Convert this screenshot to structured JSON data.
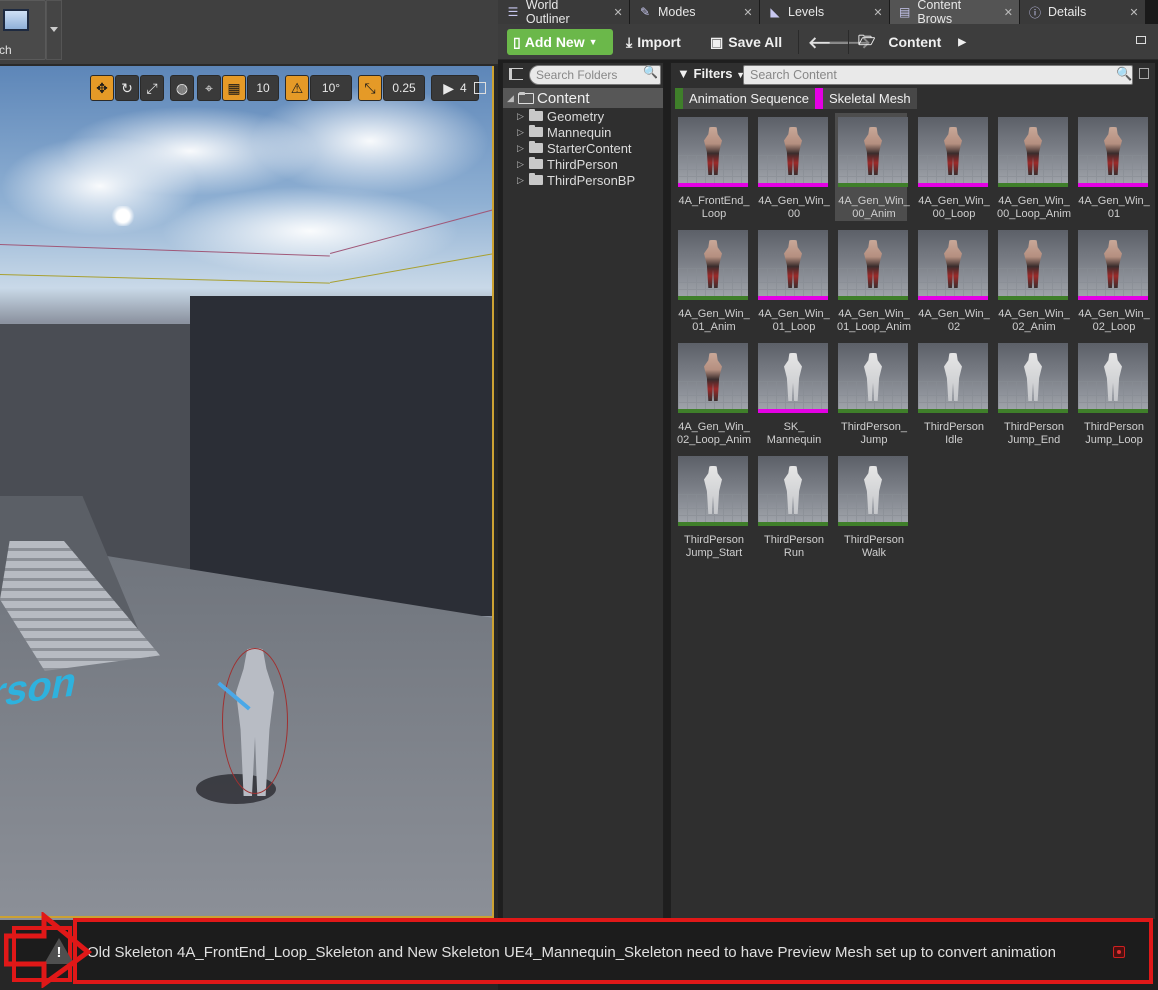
{
  "main_toolbar": {
    "launch_label": "ch"
  },
  "viewport": {
    "grid_snap": "10",
    "rot_snap": "10°",
    "scale_snap": "0.25",
    "camera_speed": "4",
    "floor_text": "rson"
  },
  "tabs": [
    {
      "label": "World Outliner",
      "icon": "list-icon",
      "active": false
    },
    {
      "label": "Modes",
      "icon": "modes-icon",
      "active": false
    },
    {
      "label": "Levels",
      "icon": "levels-icon",
      "active": false
    },
    {
      "label": "Content Brows",
      "icon": "content-browser-icon",
      "active": true
    },
    {
      "label": "Details",
      "icon": "details-icon",
      "active": false
    }
  ],
  "cb_toolbar": {
    "add_new": "Add New",
    "import": "Import",
    "save_all": "Save All",
    "path_root": "Content"
  },
  "folders": {
    "search_placeholder": "Search Folders",
    "root": "Content",
    "children": [
      "Geometry",
      "Mannequin",
      "StarterContent",
      "ThirdPerson",
      "ThirdPersonBP"
    ]
  },
  "assets": {
    "filters_label": "Filters",
    "search_placeholder": "Search Content",
    "filter_chips": [
      {
        "label": "Animation Sequence",
        "color": "#3f7f2a"
      },
      {
        "label": "Skeletal Mesh",
        "color": "#e400e4"
      }
    ],
    "items": [
      {
        "label": "4A_FrontEnd_\nLoop",
        "type": "skeletal",
        "skin": "red"
      },
      {
        "label": "4A_Gen_Win_\n00",
        "type": "skeletal",
        "skin": "red"
      },
      {
        "label": "4A_Gen_Win_\n00_Anim",
        "type": "anim",
        "skin": "red",
        "selected": true
      },
      {
        "label": "4A_Gen_Win_\n00_Loop",
        "type": "skeletal",
        "skin": "red"
      },
      {
        "label": "4A_Gen_Win_\n00_Loop_Anim",
        "type": "anim",
        "skin": "red"
      },
      {
        "label": "4A_Gen_Win_\n01",
        "type": "skeletal",
        "skin": "red"
      },
      {
        "label": "4A_Gen_Win_\n01_Anim",
        "type": "anim",
        "skin": "red"
      },
      {
        "label": "4A_Gen_Win_\n01_Loop",
        "type": "skeletal",
        "skin": "red"
      },
      {
        "label": "4A_Gen_Win_\n01_Loop_Anim",
        "type": "anim",
        "skin": "red"
      },
      {
        "label": "4A_Gen_Win_\n02",
        "type": "skeletal",
        "skin": "red"
      },
      {
        "label": "4A_Gen_Win_\n02_Anim",
        "type": "anim",
        "skin": "red"
      },
      {
        "label": "4A_Gen_Win_\n02_Loop",
        "type": "skeletal",
        "skin": "red"
      },
      {
        "label": "4A_Gen_Win_\n02_Loop_Anim",
        "type": "anim",
        "skin": "red"
      },
      {
        "label": "SK_\nMannequin",
        "type": "skeletal",
        "skin": "white"
      },
      {
        "label": "ThirdPerson_\nJump",
        "type": "anim",
        "skin": "white"
      },
      {
        "label": "ThirdPerson\nIdle",
        "type": "anim",
        "skin": "white"
      },
      {
        "label": "ThirdPerson\nJump_End",
        "type": "anim",
        "skin": "white"
      },
      {
        "label": "ThirdPerson\nJump_Loop",
        "type": "anim",
        "skin": "white"
      },
      {
        "label": "ThirdPerson\nJump_Start",
        "type": "anim",
        "skin": "white"
      },
      {
        "label": "ThirdPerson\nRun",
        "type": "anim",
        "skin": "white"
      },
      {
        "label": "ThirdPerson\nWalk",
        "type": "anim",
        "skin": "white"
      }
    ]
  },
  "notification": {
    "message": "Old Skeleton 4A_FrontEnd_Loop_Skeleton and New Skeleton UE4_Mannequin_Skeleton need to have Preview Mesh set up to convert animation",
    "icon": "warning-icon"
  },
  "colors": {
    "anim_strip": "#3f7f2a",
    "skeletal_strip": "#e400e4",
    "highlight": "#e01818",
    "add_new_green": "#6bb84a"
  }
}
